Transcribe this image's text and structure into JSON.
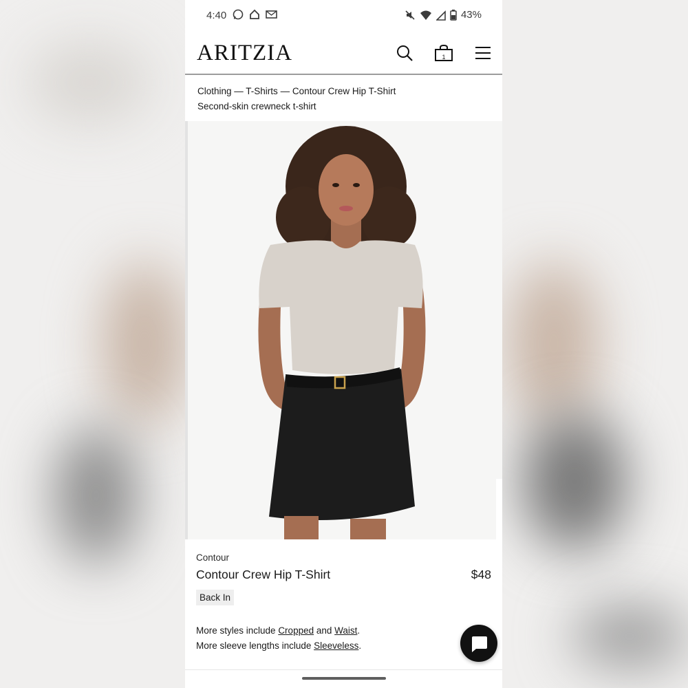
{
  "status_bar": {
    "time": "4:40",
    "battery": "43%"
  },
  "header": {
    "logo": "ARITZIA",
    "cart_count": "1"
  },
  "breadcrumb": {
    "items": [
      "Clothing",
      "T-Shirts",
      "Contour Crew Hip T-Shirt"
    ],
    "separator": " — "
  },
  "subtitle": "Second-skin crewneck t-shirt",
  "product": {
    "brand": "Contour",
    "name": "Contour Crew Hip T-Shirt",
    "price": "$48",
    "badge": "Back In"
  },
  "more_styles": {
    "line1_prefix": "More styles include ",
    "link1": "Cropped",
    "line1_mid": " and ",
    "link2": "Waist",
    "line1_end": ".",
    "line2_prefix": "More sleeve lengths include ",
    "link3": "Sleeveless",
    "line2_end": "."
  },
  "icons": [
    "whatsapp-icon",
    "home-icon",
    "mail-icon",
    "mute-icon",
    "wifi-icon",
    "signal-icon",
    "battery-icon",
    "search-icon",
    "cart-icon",
    "menu-icon",
    "chat-icon"
  ],
  "colors": {
    "accent": "#111111",
    "tee": "#d8d2cb",
    "skirt": "#1c1c1c"
  }
}
